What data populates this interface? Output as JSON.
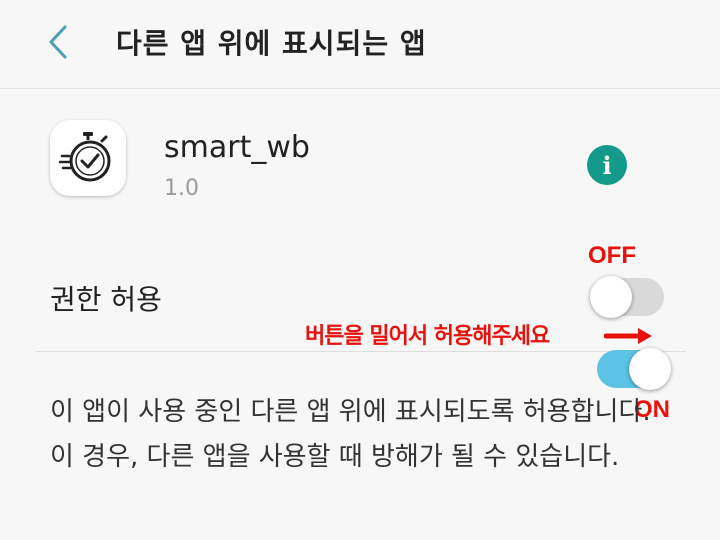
{
  "header": {
    "title": "다른 앱 위에 표시되는 앱",
    "back_icon": "chevron-left-icon",
    "back_color": "#4a9fb5"
  },
  "app": {
    "name": "smart_wb",
    "version": "1.0",
    "icon": "stopwatch-icon",
    "info_icon": "info-icon",
    "info_color": "#139a8a"
  },
  "permission": {
    "label": "권한 허용",
    "toggle_off_state": false,
    "toggle_on_state": true,
    "toggle_on_color": "#5cc3e4",
    "toggle_off_color": "#d9d9d9"
  },
  "annotations": {
    "off_label": "OFF",
    "on_label": "ON",
    "instruction": "버튼을 밀어서 허용해주세요",
    "arrow_icon": "arrow-right-icon",
    "color": "#e8120c"
  },
  "description": "이 앱이 사용 중인 다른 앱 위에 표시되도록 허용합니다. 이 경우, 다른 앱을 사용할 때 방해가 될 수 있습니다."
}
